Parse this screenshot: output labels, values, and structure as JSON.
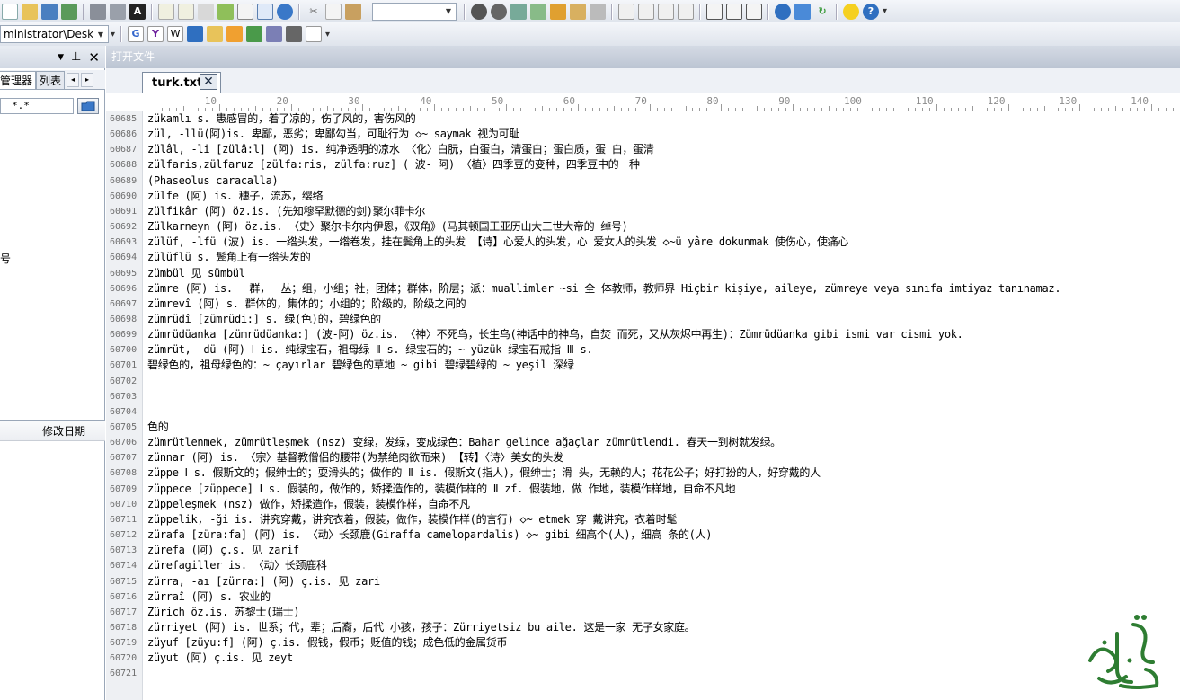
{
  "toolbar": {
    "font_combo_value": "",
    "path_combo_value": "ministrator\\Desk"
  },
  "left_panel": {
    "tab_explorer": "管理器",
    "tab_list": "列表",
    "filter_value": "*.*",
    "side_fragment": "号",
    "column_modified": "修改日期"
  },
  "document": {
    "title": "打开文件",
    "tab_label": "turk.txt"
  },
  "ruler": [
    "10",
    "20",
    "30",
    "40",
    "50",
    "60",
    "70",
    "80",
    "90",
    "100",
    "110",
    "120",
    "130",
    "140"
  ],
  "lines": [
    {
      "n": "60685",
      "t": "zükamlı s.  患感冒的，着了凉的，伤了风的，害伤风的"
    },
    {
      "n": "60686",
      "t": "zül, -llü(阿)is.  卑鄙，恶劣；卑鄙勾当，可耻行为 ◇~ saymak 视为可耻"
    },
    {
      "n": "60687",
      "t": "zülâl, -li [zülâ:l] (阿) is.  纯净透明的凉水  〈化〉白朊，白蛋白，清蛋白；蛋白质，蛋 白，蛋清"
    },
    {
      "n": "60688",
      "t": "zülfaris,zülfaruz  [zülfa:ris,  zülfa:ruz]  ( 波- 阿)  〈植〉四季豆的变种，四季豆中的一种"
    },
    {
      "n": "60689",
      "t": "(Phaseolus caracalla)"
    },
    {
      "n": "60690",
      "t": "zülfe  (阿) is. 穗子，流苏，缨络"
    },
    {
      "n": "60691",
      "t": "zülfikâr  (阿) öz.is. (先知穆罕默德的剑)聚尔菲卡尔"
    },
    {
      "n": "60692",
      "t": "Zülkarneyn  (阿) öz.is.  〈史〉聚尔卡尔内伊恩，《双角》(马其顿国王亚历山大三世大帝的 绰号)"
    },
    {
      "n": "60693",
      "t": "zülüf,  -lfü (波) is.   一绺头发，一绺卷发，挂在鬓角上的头发   【诗】心爱人的头发，心 爱女人的头发 ◇~ü yâre dokunmak 使伤心，使痛心"
    },
    {
      "n": "60694",
      "t": "zülüflü  s.  鬓角上有一绺头发的"
    },
    {
      "n": "60695",
      "t": "zümbül 见 sümbül"
    },
    {
      "n": "60696",
      "t": "zümre (阿) is.   一群，一丛；组，小组；社，团体；群体，阶层；派：muallimler ~si  全 体教师，教师界 Hiçbir kişiye, aileye, zümreye veya sınıfa imtiyaz tanınamaz."
    },
    {
      "n": "60697",
      "t": "zümrevî  (阿) s.  群体的，集体的；小组的；阶级的，阶级之间的"
    },
    {
      "n": "60698",
      "t": "zümrüdî  [zümrüdi:] s.  绿(色)的，碧绿色的"
    },
    {
      "n": "60699",
      "t": "zümrüdüanka [zümrüdüanka:] (波-阿) öz.is.  〈神〉不死鸟，长生鸟(神话中的神鸟，自焚 而死，又从灰烬中再生)：Zümrüdüanka gibi ismi var cismi yok."
    },
    {
      "n": "60700",
      "t": "zümrüt, -dü (阿)  Ⅰ is. 纯绿宝石，祖母绿 Ⅱ s.  绿宝石的；~ yüzük  绿宝石戒指 Ⅲ s."
    },
    {
      "n": "60701",
      "t": "碧绿色的，祖母绿色的：~  çayırlar  碧绿色的草地 ~ gibi 碧绿碧绿的 ~ yeşil  深绿"
    },
    {
      "n": "60702",
      "t": ""
    },
    {
      "n": "60703",
      "t": ""
    },
    {
      "n": "60704",
      "t": ""
    },
    {
      "n": "60705",
      "t": "色的"
    },
    {
      "n": "60706",
      "t": "zümrütlenmek,  zümrütleşmek  (nsz)  变绿，发绿，变成绿色：Bahar  gelince  ağaçlar zümrütlendi.  春天一到树就发绿。"
    },
    {
      "n": "60707",
      "t": "zünnar (阿) is.   〈宗〉基督教僧侣的腰带(为禁绝肉欲而来)   【转】〈诗〉美女的头发"
    },
    {
      "n": "60708",
      "t": "züppe   Ⅰ s.  假斯文的；假绅士的；耍滑头的；做作的 Ⅱ is. 假斯文(指人)，假绅士；滑 头，无赖的人；花花公子；好打扮的人，好穿戴的人"
    },
    {
      "n": "60709",
      "t": "züppece [züppece]   Ⅰ s.  假装的，做作的，矫揉造作的，装模作样的 Ⅱ zf.  假装地，做 作地，装模作样地，自命不凡地"
    },
    {
      "n": "60710",
      "t": "züppeleşmek (nsz)  做作，矫揉造作，假装，装模作样，自命不凡"
    },
    {
      "n": "60711",
      "t": "züppelik, -ği is. 讲究穿戴，讲究衣着，假装，做作，装模作样(的言行) ◇~  etmek 穿 戴讲究，衣着时髦"
    },
    {
      "n": "60712",
      "t": "zürafa [züra:fa] (阿) is.  〈动〉长颈鹿(Giraffa camelopardalis)  ◇~ gibi  细高个(人)，细高 条的(人)"
    },
    {
      "n": "60713",
      "t": "zürefa (阿) ç.s.  见 zarif"
    },
    {
      "n": "60714",
      "t": "zürefagiller is.  〈动〉长颈鹿科"
    },
    {
      "n": "60715",
      "t": "zürra, -aı [zürra:] (阿) ç.is. 见 zari"
    },
    {
      "n": "60716",
      "t": "zürraî (阿) s.  农业的"
    },
    {
      "n": "60717",
      "t": "Zürich öz.is.  苏黎士(瑞士)"
    },
    {
      "n": "60718",
      "t": "zürriyet (阿) is.   世系；代，辈；后裔，后代   小孩，孩子：Zürriyetsiz bu aile.  这是一家 无子女家庭。"
    },
    {
      "n": "60719",
      "t": "züyuf [züyu:f] (阿) ç.is. 假钱，假币；贬值的钱；成色低的金属货币"
    },
    {
      "n": "60720",
      "t": "züyut (阿) ç.is. 见 zeyt"
    },
    {
      "n": "60721",
      "t": ""
    }
  ],
  "colors": {
    "toolbar_bg": "#e6eaf0",
    "gutter_bg": "#eef0f3",
    "line_number": "#6e6e6e",
    "doc_title_bg": "#c8d0dc",
    "watermark": "#2e7d32"
  }
}
